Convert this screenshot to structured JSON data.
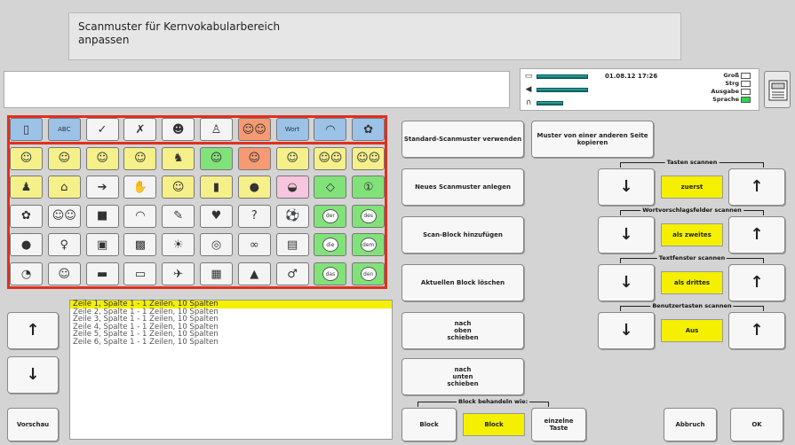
{
  "header": {
    "title_line1": "Scanmuster für Kernvokabularbereich",
    "title_line2": "anpassen"
  },
  "status": {
    "datetime": "01.08.12 17:26",
    "labels": [
      "Groß",
      "Strg",
      "Ausgabe",
      "Sprache"
    ],
    "active_label": "Sprache"
  },
  "grid": {
    "rows": [
      [
        {
          "c": "blue",
          "t": "▯"
        },
        {
          "c": "blue",
          "t": "ABC"
        },
        {
          "c": "white",
          "t": "✓"
        },
        {
          "c": "white",
          "t": "✗"
        },
        {
          "c": "white",
          "t": "☻"
        },
        {
          "c": "white",
          "t": "♙"
        },
        {
          "c": "orange",
          "t": "☺☺"
        },
        {
          "c": "blue",
          "t": "Wort"
        },
        {
          "c": "blue",
          "t": "◠"
        },
        {
          "c": "blue",
          "t": "✿"
        }
      ],
      [
        {
          "c": "yellow",
          "t": "☺"
        },
        {
          "c": "yellow",
          "t": "☺"
        },
        {
          "c": "yellow",
          "t": "☺"
        },
        {
          "c": "yellow",
          "t": "☺"
        },
        {
          "c": "yellow",
          "t": "♞"
        },
        {
          "c": "green",
          "t": "☺"
        },
        {
          "c": "orange",
          "t": "☺"
        },
        {
          "c": "yellow",
          "t": "☺"
        },
        {
          "c": "yellow",
          "t": "☺☺"
        },
        {
          "c": "yellow",
          "t": "☺☺"
        }
      ],
      [
        {
          "c": "yellow",
          "t": "♟"
        },
        {
          "c": "yellow",
          "t": "⌂"
        },
        {
          "c": "white",
          "t": "➔"
        },
        {
          "c": "white",
          "t": "✋"
        },
        {
          "c": "yellow",
          "t": "☺"
        },
        {
          "c": "yellow",
          "t": "▮"
        },
        {
          "c": "yellow",
          "t": "●"
        },
        {
          "c": "pink",
          "t": "◒"
        },
        {
          "c": "green",
          "t": "◇"
        },
        {
          "c": "green",
          "t": "①"
        }
      ],
      [
        {
          "c": "white",
          "t": "✿"
        },
        {
          "c": "white",
          "t": "☺☺"
        },
        {
          "c": "white",
          "t": "■"
        },
        {
          "c": "white",
          "t": "◠"
        },
        {
          "c": "white",
          "t": "✎"
        },
        {
          "c": "white",
          "t": "♥"
        },
        {
          "c": "white",
          "t": "?"
        },
        {
          "c": "white",
          "t": "⚽"
        },
        {
          "c": "green",
          "t": "der"
        },
        {
          "c": "green",
          "t": "des"
        }
      ],
      [
        {
          "c": "white",
          "t": "●"
        },
        {
          "c": "white",
          "t": "♀"
        },
        {
          "c": "white",
          "t": "▣"
        },
        {
          "c": "white",
          "t": "▩"
        },
        {
          "c": "white",
          "t": "☀"
        },
        {
          "c": "white",
          "t": "◎"
        },
        {
          "c": "white",
          "t": "∞"
        },
        {
          "c": "white",
          "t": "▤"
        },
        {
          "c": "green",
          "t": "die"
        },
        {
          "c": "green",
          "t": "dem"
        }
      ],
      [
        {
          "c": "white",
          "t": "◔"
        },
        {
          "c": "white",
          "t": "☺"
        },
        {
          "c": "white",
          "t": "▬"
        },
        {
          "c": "white",
          "t": "▭"
        },
        {
          "c": "white",
          "t": "✈"
        },
        {
          "c": "white",
          "t": "▦"
        },
        {
          "c": "white",
          "t": "▲"
        },
        {
          "c": "white",
          "t": "♂"
        },
        {
          "c": "green",
          "t": "das"
        },
        {
          "c": "green",
          "t": "den"
        }
      ]
    ]
  },
  "blocks": [
    "Zeile 1, Spalte 1 - 1 Zeilen, 10 Spalten",
    "Zeile 2, Spalte 1 - 1 Zeilen, 10 Spalten",
    "Zeile 3, Spalte 1 - 1 Zeilen, 10 Spalten",
    "Zeile 4, Spalte 1 - 1 Zeilen, 10 Spalten",
    "Zeile 5, Spalte 1 - 1 Zeilen, 10 Spalten",
    "Zeile 6, Spalte 1 - 1 Zeilen, 10 Spalten"
  ],
  "middle": {
    "standard": "Standard-Scanmuster verwenden",
    "copy_line1": "Muster von einer anderen Seite",
    "copy_line2": "kopieren",
    "new": "Neues Scanmuster anlegen",
    "add": "Scan-Block hinzufügen",
    "delete": "Aktuellen Block löschen",
    "up": [
      "nach",
      "oben",
      "schieben"
    ],
    "down": [
      "nach",
      "unten",
      "schieben"
    ],
    "treat_label": "Block behandeln wie:",
    "treat_block": "Block",
    "treat_selected": "Block",
    "treat_single": [
      "einzelne",
      "Taste"
    ]
  },
  "right": {
    "groups": [
      {
        "label": "Tasten scannen",
        "value": "zuerst"
      },
      {
        "label": "Wortvorschlagsfelder scannen",
        "value": "als zweites"
      },
      {
        "label": "Textfenster scannen",
        "value": "als drittes"
      },
      {
        "label": "Benutzertasten scannen",
        "value": "Aus"
      }
    ],
    "down_arrow": "↓",
    "up_arrow": "↑"
  },
  "left": {
    "up_arrow": "↑",
    "down_arrow": "↓",
    "preview": "Vorschau"
  },
  "footer": {
    "cancel": "Abbruch",
    "ok": "OK"
  }
}
